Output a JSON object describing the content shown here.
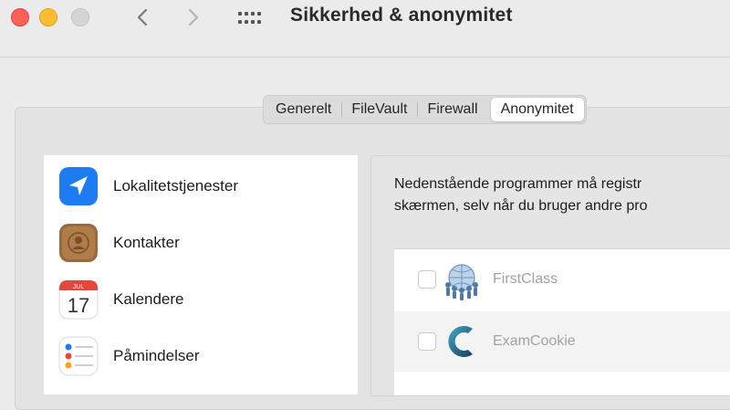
{
  "window": {
    "title": "Sikkerhed & anonymitet",
    "traffic_lights": [
      "close",
      "minimize",
      "zoom"
    ],
    "nav": {
      "back_icon": "chevron-left-icon",
      "forward_icon": "chevron-right-icon",
      "grid_icon": "grid-icon"
    }
  },
  "tabs": [
    {
      "label": "Generelt",
      "selected": false
    },
    {
      "label": "FileVault",
      "selected": false
    },
    {
      "label": "Firewall",
      "selected": false
    },
    {
      "label": "Anonymitet",
      "selected": true
    }
  ],
  "sidebar": {
    "items": [
      {
        "label": "Lokalitetstjenester",
        "icon": "location-arrow-icon"
      },
      {
        "label": "Kontakter",
        "icon": "contacts-icon"
      },
      {
        "label": "Kalendere",
        "icon": "calendar-icon",
        "calendar_month": "JUL",
        "calendar_day": "17"
      },
      {
        "label": "Påmindelser",
        "icon": "reminders-icon"
      }
    ]
  },
  "content": {
    "description_line1": "Nedenstående programmer må registr",
    "description_line2": "skærmen, selv når du bruger andre pro",
    "apps": [
      {
        "name": "FirstClass",
        "checked": false,
        "icon": "firstclass-globe-icon"
      },
      {
        "name": "ExamCookie",
        "checked": false,
        "icon": "examcookie-logo-icon"
      }
    ]
  },
  "colors": {
    "close": "#fe5f57",
    "minimize": "#febc2e",
    "zoom_inactive": "#d4d4d4",
    "location_blue": "#1e7cf2",
    "contacts_brown": "#9a6a3e",
    "calendar_red": "#e8453c"
  }
}
